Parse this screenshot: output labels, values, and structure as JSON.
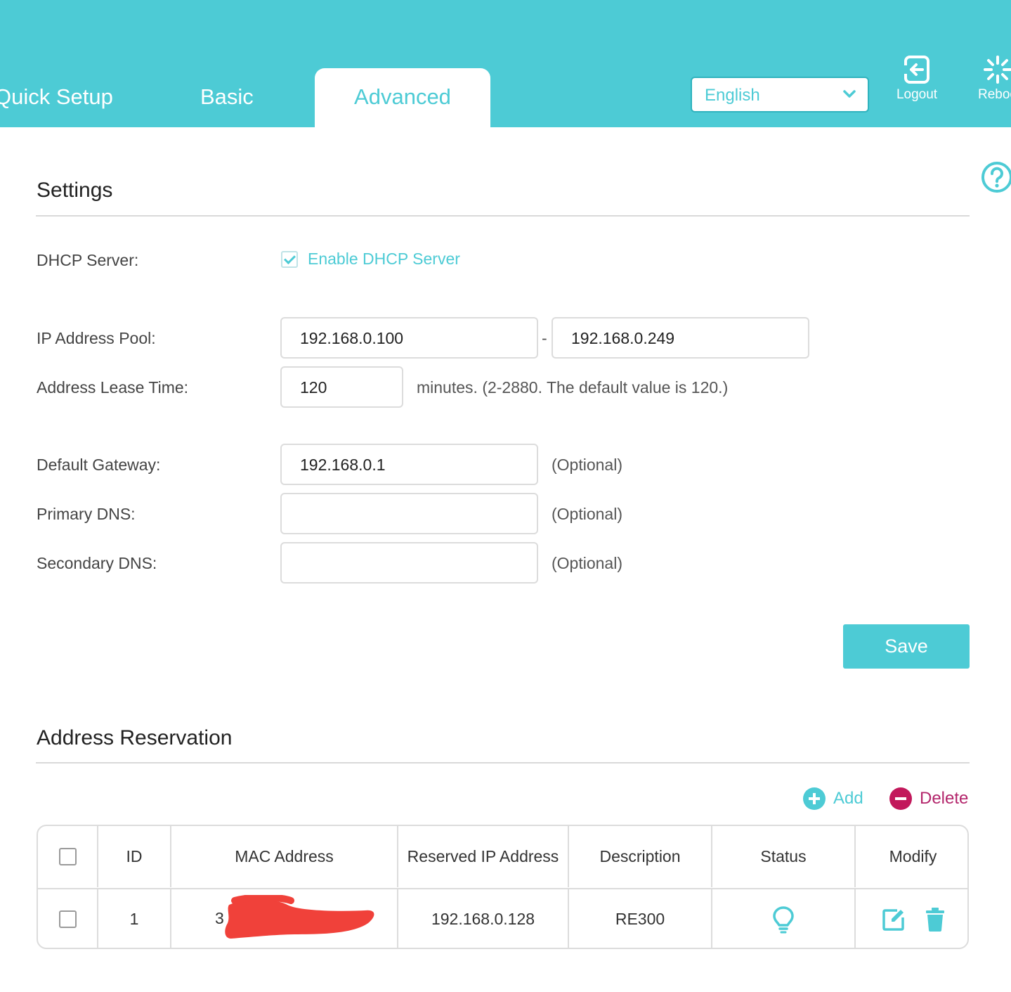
{
  "header": {
    "tabs": [
      {
        "label": "Quick Setup"
      },
      {
        "label": "Basic"
      },
      {
        "label": "Advanced",
        "active": true
      }
    ],
    "language": {
      "value": "English"
    },
    "logout_label": "Logout",
    "reboot_label": "Reboo",
    "accent_color": "#4dcbd5"
  },
  "settings": {
    "title": "Settings",
    "dhcp_server": {
      "label": "DHCP Server:",
      "checkbox_label": "Enable DHCP Server",
      "checked": true
    },
    "ip_pool": {
      "label": "IP Address Pool:",
      "start": "192.168.0.100",
      "separator": "-",
      "end": "192.168.0.249"
    },
    "lease_time": {
      "label": "Address Lease Time:",
      "value": "120",
      "hint": "minutes. (2-2880. The default value is 120.)"
    },
    "default_gateway": {
      "label": "Default Gateway:",
      "value": "192.168.0.1",
      "hint": "(Optional)"
    },
    "primary_dns": {
      "label": "Primary DNS:",
      "value": "",
      "hint": "(Optional)"
    },
    "secondary_dns": {
      "label": "Secondary DNS:",
      "value": "",
      "hint": "(Optional)"
    },
    "save_label": "Save"
  },
  "reservation": {
    "title": "Address Reservation",
    "add_label": "Add",
    "delete_label": "Delete",
    "columns": [
      "ID",
      "MAC Address",
      "Reserved IP Address",
      "Description",
      "Status",
      "Modify"
    ],
    "rows": [
      {
        "id": "1",
        "mac_visible": "3",
        "ip": "192.168.0.128",
        "description": "RE300",
        "status_icon": "bulb-icon"
      }
    ]
  }
}
